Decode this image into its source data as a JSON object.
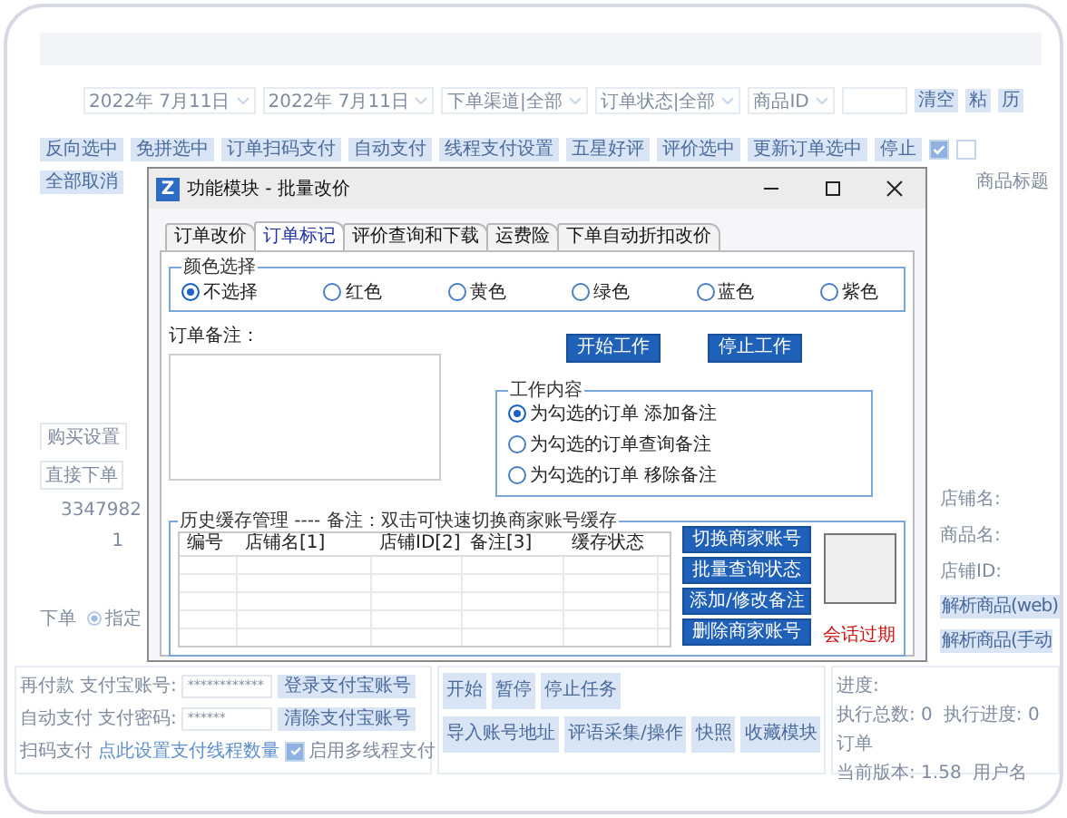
{
  "background": {
    "filter_row": {
      "dates": [
        "2022年 7月11日",
        "2022年 7月11日"
      ],
      "selects": [
        "下单渠道|全部",
        "订单状态|全部",
        "商品ID"
      ],
      "side_buttons": [
        "清空",
        "粘",
        "历"
      ]
    },
    "action_buttons": [
      "反向选中",
      "免拼选中",
      "订单扫码支付",
      "自动支付",
      "线程支付设置",
      "五星好评",
      "评价选中",
      "更新订单选中",
      "停止"
    ],
    "action_checks": [
      {
        "checked": true
      },
      {
        "checked": false
      }
    ],
    "action_buttons_2": [
      "全部取消"
    ],
    "column_header": "商品标题",
    "left_panel": {
      "tab": "购买设置",
      "field_value": "直接下单",
      "number": "3347982",
      "digit": "1",
      "label": "下单",
      "radio": {
        "label": "指定",
        "selected": true
      }
    },
    "right_panel": {
      "lines": [
        "店铺名:",
        "商品名:",
        "店铺ID:"
      ],
      "buttons": [
        "解析商品(web)",
        "解析商品(手动"
      ]
    },
    "pay_panel": {
      "rows": [
        {
          "label": "再付款",
          "field_label": "支付宝账号:",
          "value": "************",
          "button": "登录支付宝账号"
        },
        {
          "label": "自动支付",
          "field_label": "支付密码:",
          "value": "******",
          "button": "清除支付宝账号"
        }
      ],
      "link_row": {
        "label": "扫码支付",
        "link": "点此设置支付线程数量",
        "checkbox": {
          "label": "启用多线程支付",
          "checked": true
        }
      }
    },
    "control_rows": [
      [
        "开始",
        "暂停",
        "停止任务"
      ],
      [
        "导入账号地址",
        "评语采集/操作",
        "快照",
        "收藏模块"
      ]
    ],
    "status_panel": {
      "progress_label": "进度:",
      "stats": [
        "执行总数: 0",
        "执行进度: 0",
        "订单"
      ],
      "version": "当前版本: 1.58",
      "user_label": "用户名"
    }
  },
  "dialog": {
    "app_icon_letter": "Z",
    "title": "功能模块 - 批量改价",
    "tabs": [
      {
        "label": "订单改价",
        "selected": false
      },
      {
        "label": "订单标记",
        "selected": true
      },
      {
        "label": "评价查询和下载",
        "selected": false
      },
      {
        "label": "运费险",
        "selected": false
      },
      {
        "label": "下单自动折扣改价",
        "selected": false
      }
    ],
    "color_group": {
      "label": "颜色选择",
      "options": [
        {
          "label": "不选择",
          "selected": true
        },
        {
          "label": "红色",
          "selected": false
        },
        {
          "label": "黄色",
          "selected": false
        },
        {
          "label": "绿色",
          "selected": false
        },
        {
          "label": "蓝色",
          "selected": false
        },
        {
          "label": "紫色",
          "selected": false
        }
      ]
    },
    "remark_label": "订单备注：",
    "work_buttons": [
      "开始工作",
      "停止工作"
    ],
    "work_group": {
      "label": "工作内容",
      "options": [
        {
          "label": "为勾选的订单 添加备注",
          "selected": true
        },
        {
          "label": "为勾选的订单查询备注",
          "selected": false
        },
        {
          "label": "为勾选的订单 移除备注",
          "selected": false
        }
      ]
    },
    "history": {
      "label": "历史缓存管理 ---- 备注：双击可快速切换商家账号缓存",
      "columns": [
        "编号",
        "店铺名[1]",
        "店铺ID[2]",
        "备注[3]",
        "缓存状态"
      ],
      "actions": [
        "切换商家账号",
        "批量查询状态",
        "添加/修改备注",
        "删除商家账号"
      ],
      "status": "会话过期"
    }
  }
}
